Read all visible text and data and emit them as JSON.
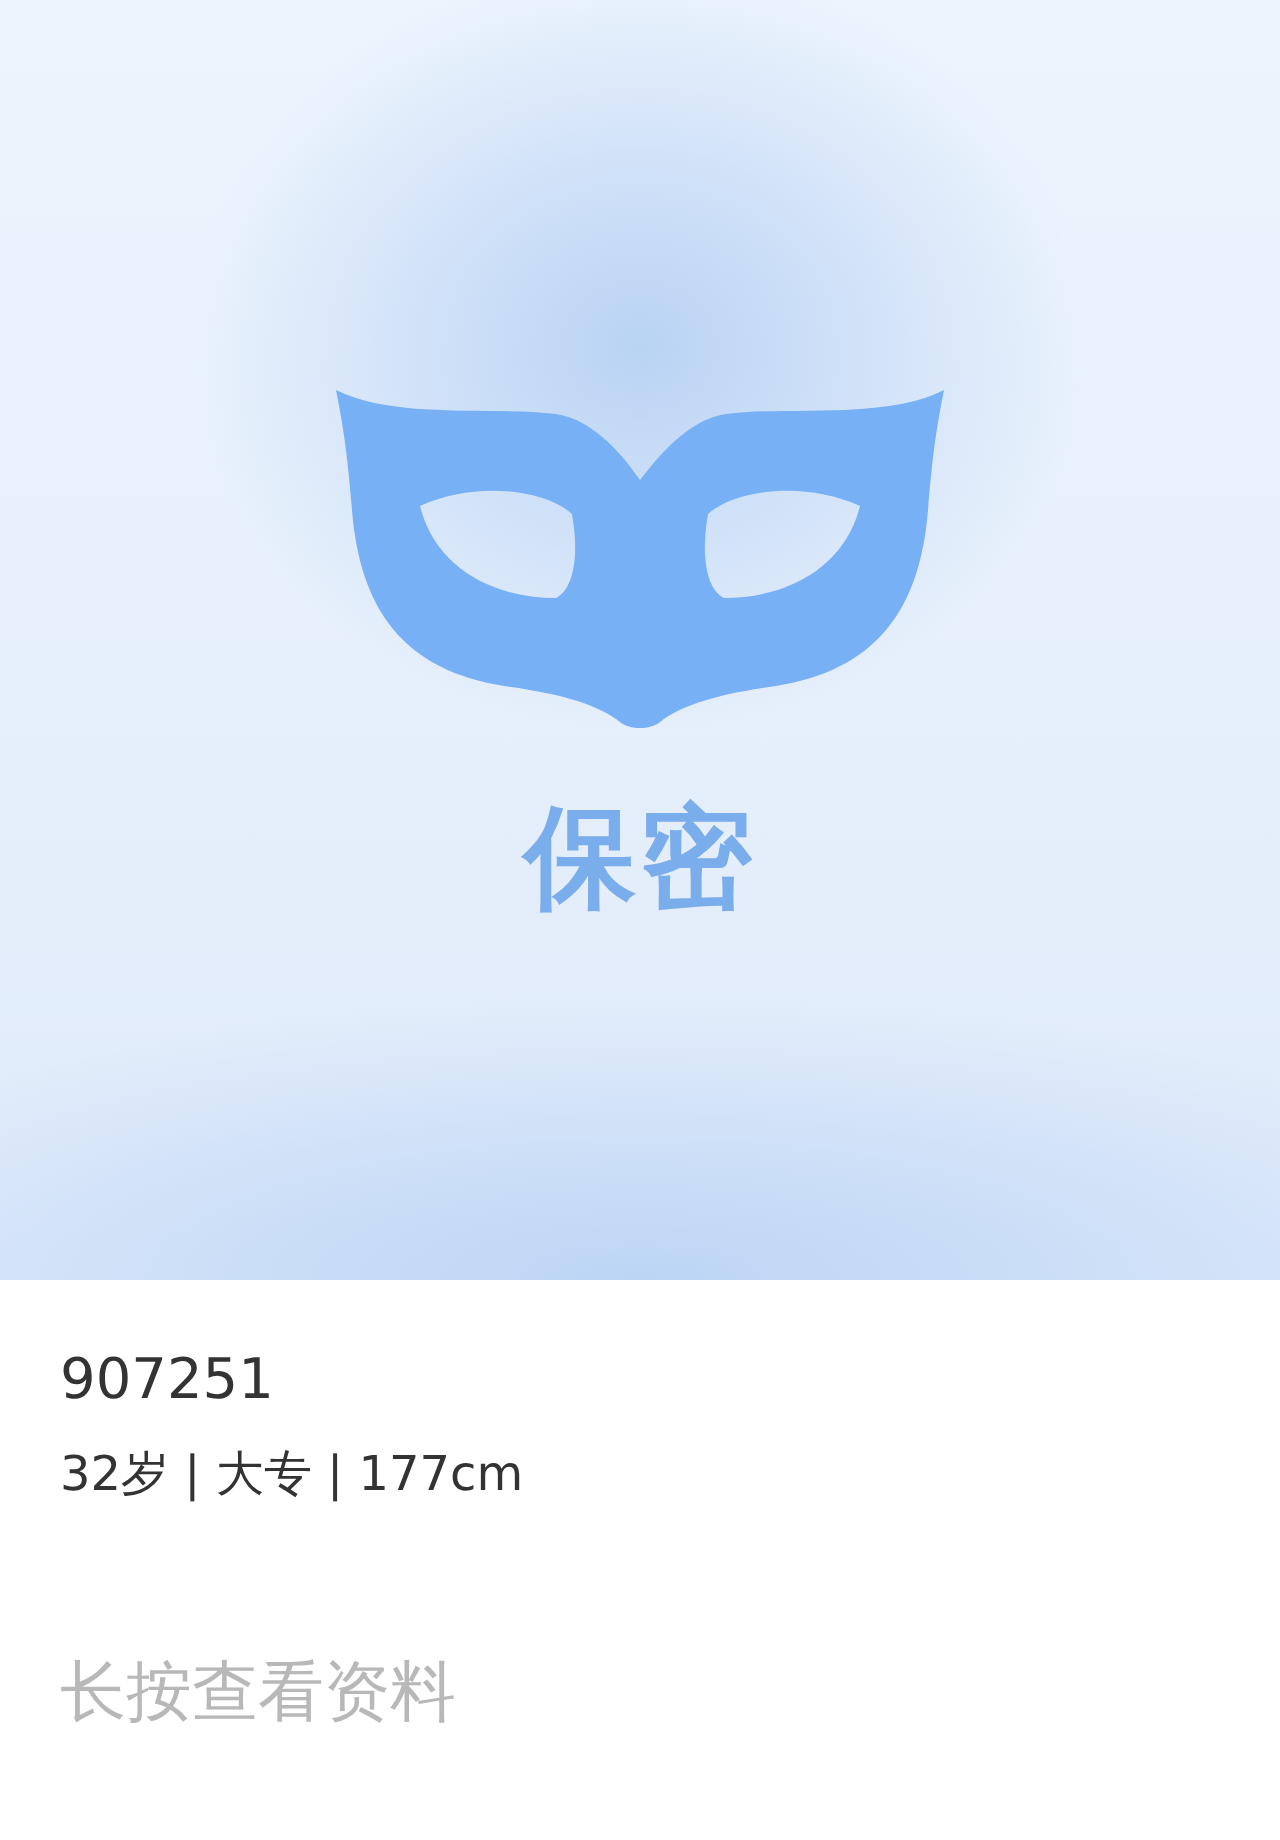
{
  "cover": {
    "label": "保密"
  },
  "profile": {
    "id": "907251",
    "details": "32岁 | 大专 | 177cm",
    "hint": "长按查看资料"
  }
}
